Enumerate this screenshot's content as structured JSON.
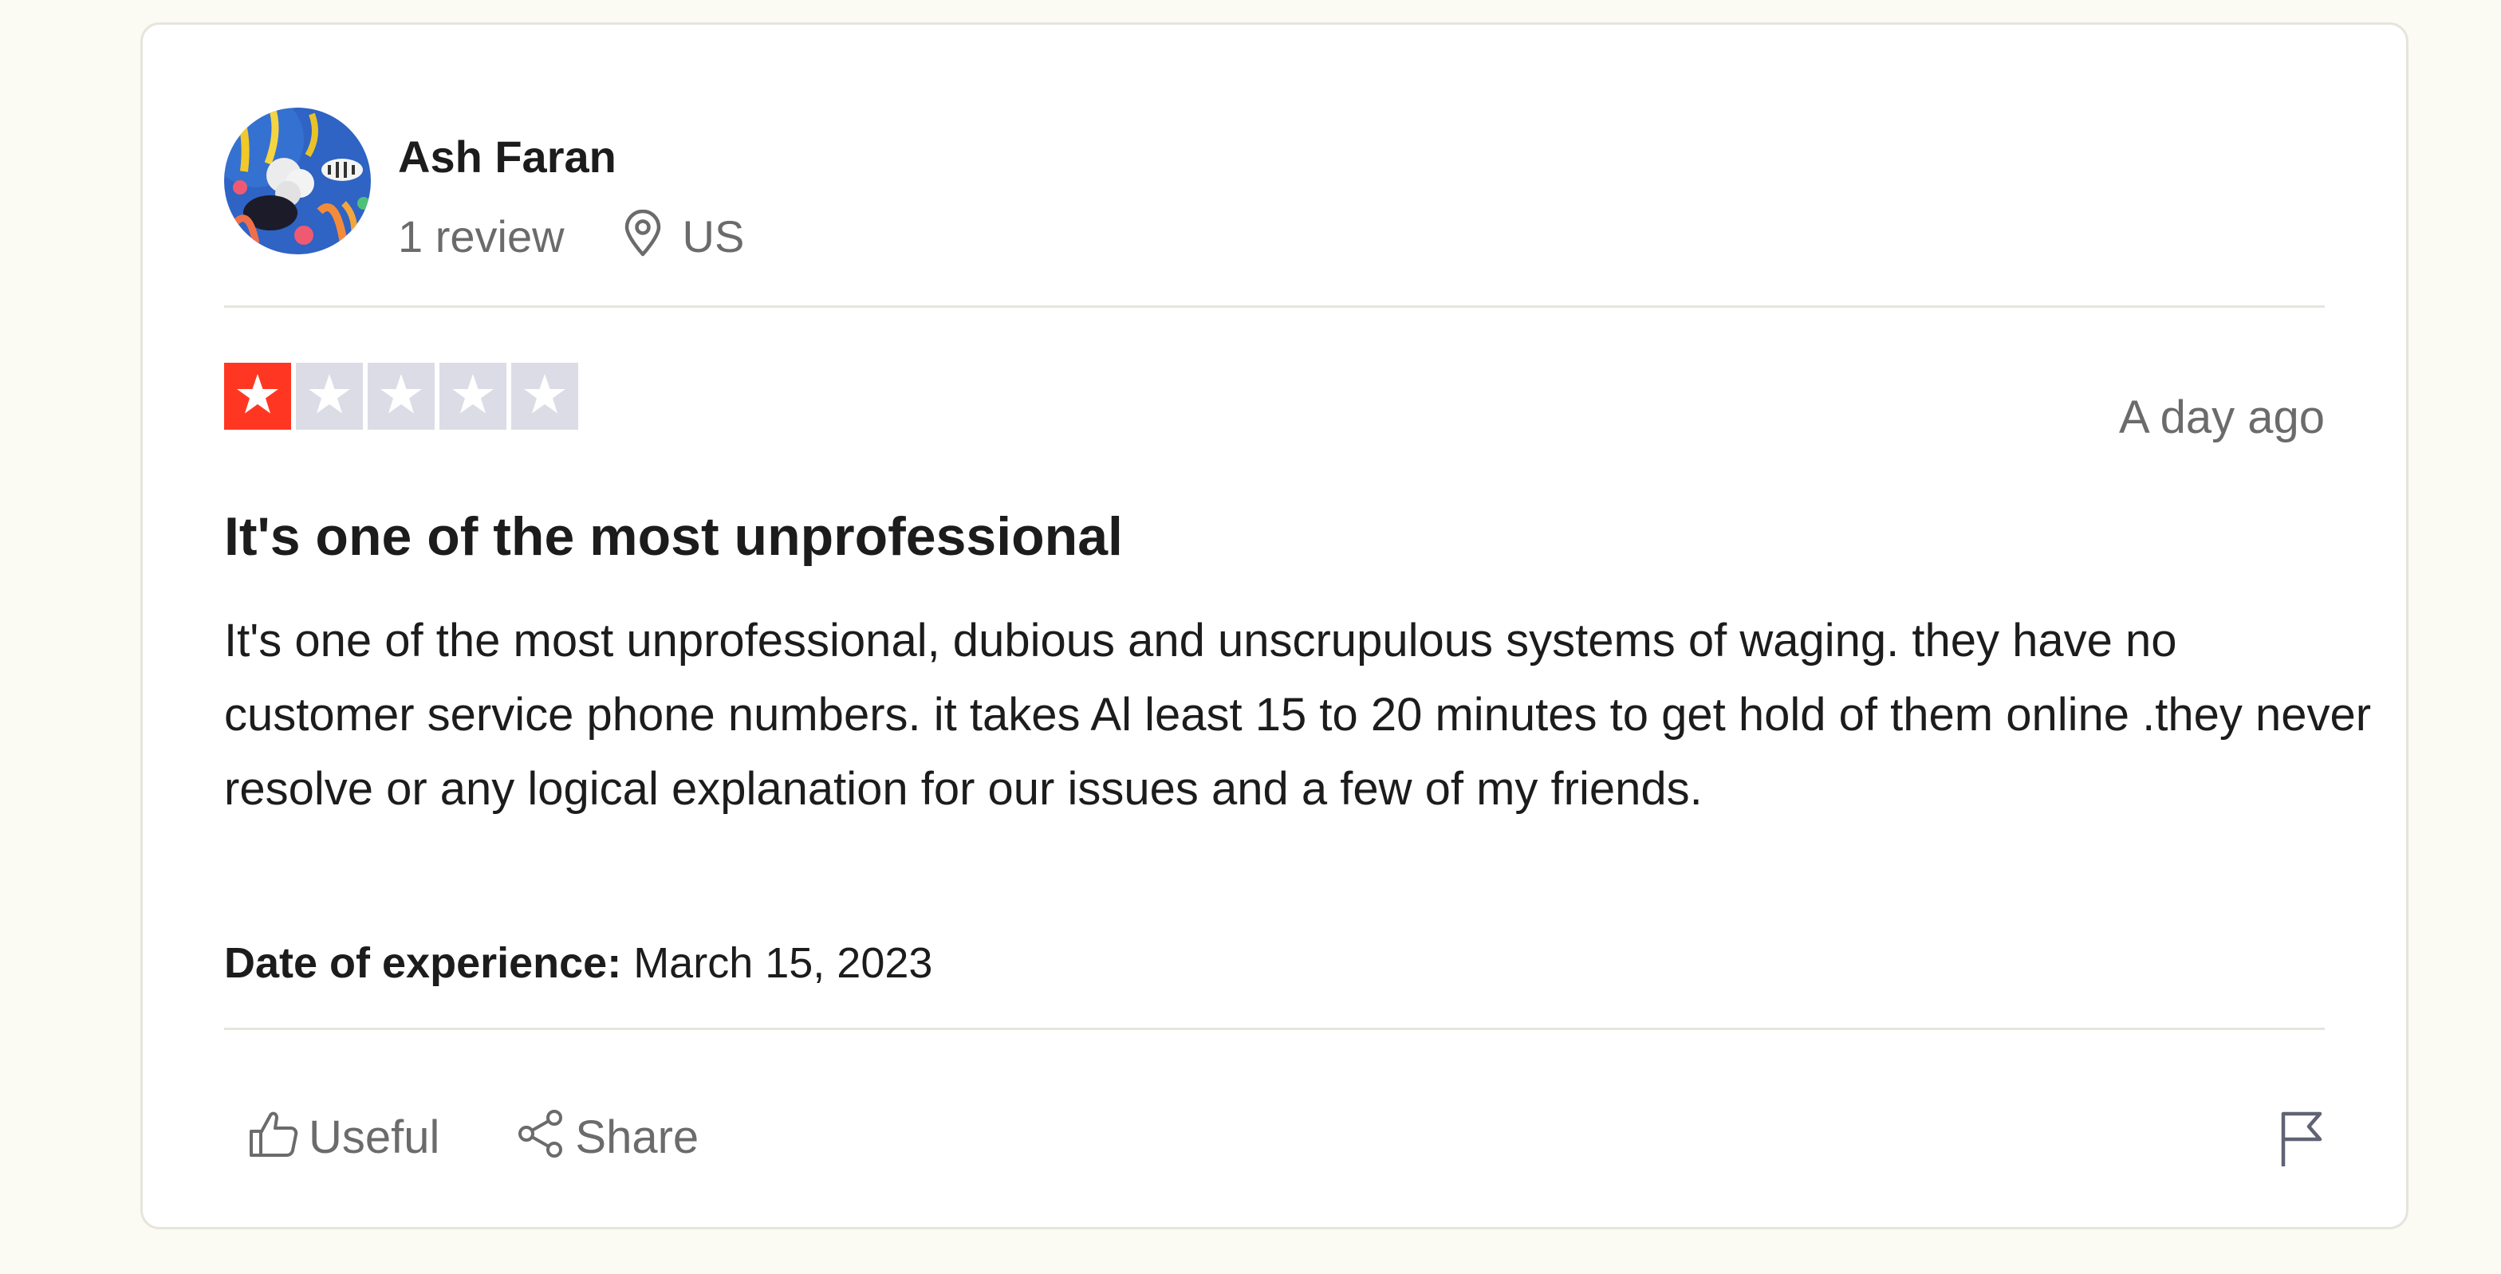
{
  "reviewer": {
    "name": "Ash Faran",
    "review_count": "1 review",
    "country": "US"
  },
  "review": {
    "rating": 1,
    "max_rating": 5,
    "posted": "A day ago",
    "title": "It's one of the most unprofessional",
    "body": "It's one of the most unprofessional, dubious and unscrupulous systems of waging. they have no customer service phone numbers. it takes Al least 15 to 20 minutes to get hold of them online .they never resolve or any logical explanation for our issues and a few of my friends.",
    "experience_label": "Date of experience:",
    "experience_date": "March 15, 2023"
  },
  "actions": {
    "useful_label": "Useful",
    "share_label": "Share"
  },
  "icons": {
    "location": "map-pin-icon",
    "useful": "thumbs-up-icon",
    "share": "share-icon",
    "report": "flag-icon",
    "star": "star-icon"
  },
  "colors": {
    "star_filled": "#ff3722",
    "star_empty": "#dcdce6",
    "page_background": "#fbfaf3",
    "muted_text": "#6b6b6b"
  }
}
